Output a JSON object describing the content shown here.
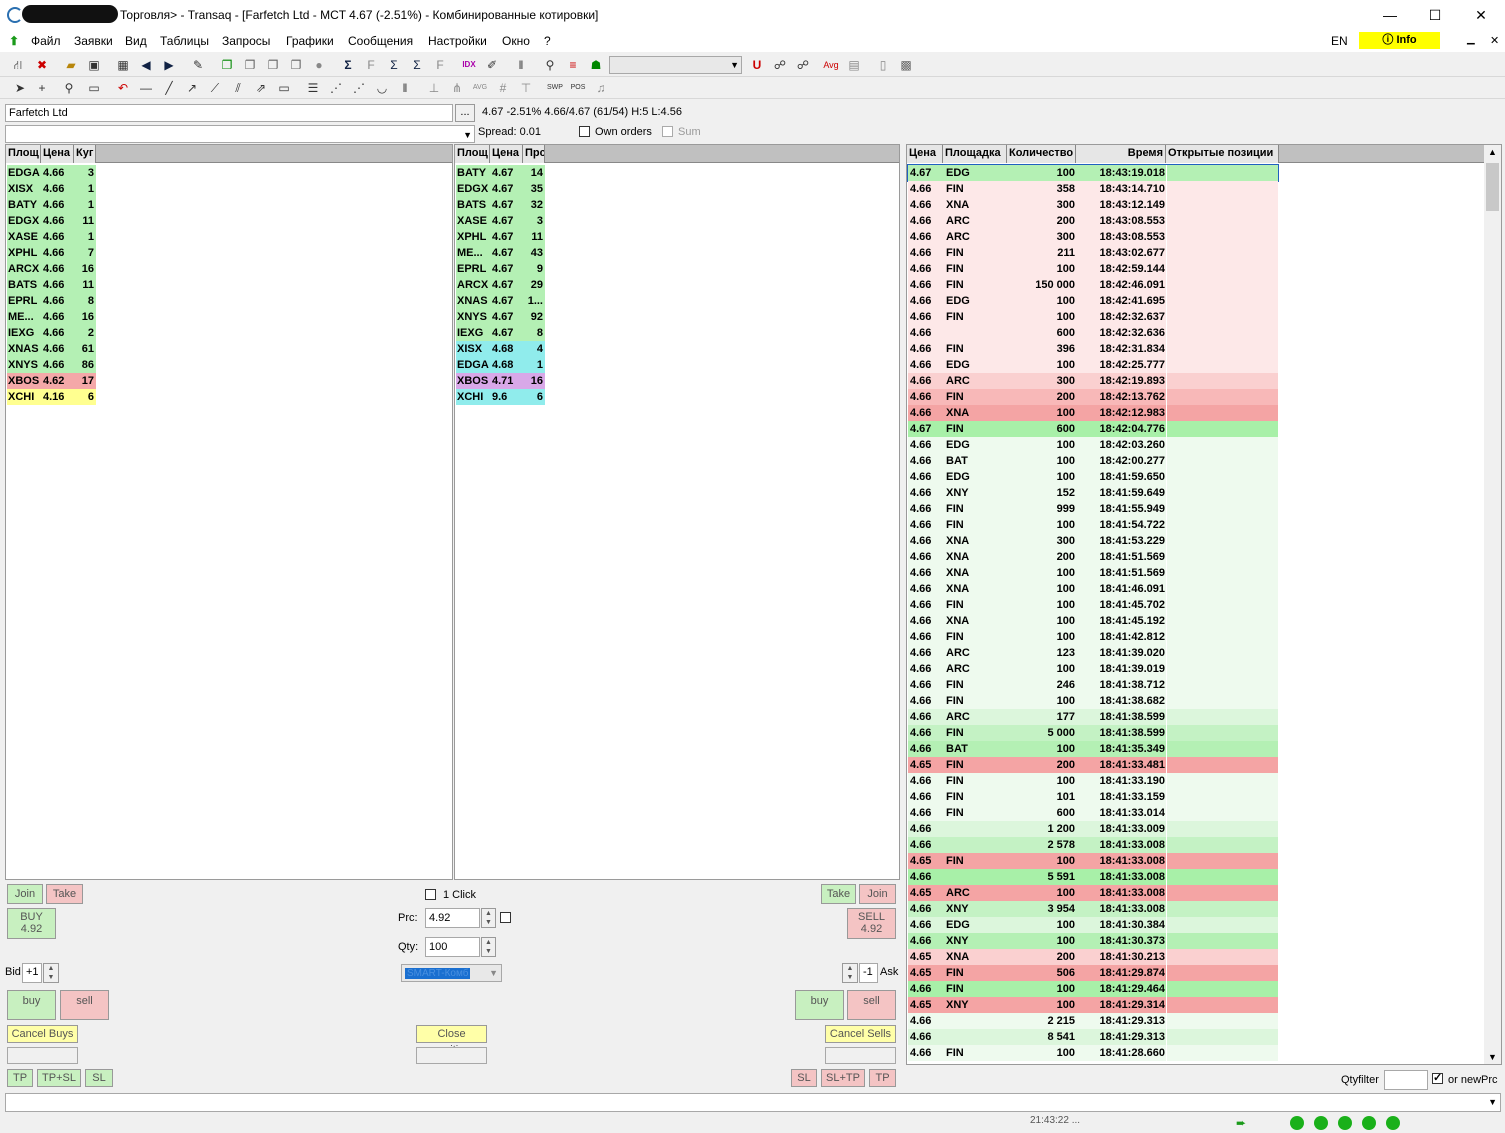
{
  "title": "Торговля> - Transaq - [Farfetch Ltd - MCT 4.67 (-2.51%) - Комбинированные котировки]",
  "menu": [
    "Файл",
    "Заявки",
    "Вид",
    "Таблицы",
    "Запросы",
    "Графики",
    "Сообщения",
    "Настройки",
    "Окно",
    "?"
  ],
  "lang": "EN",
  "info_label": "Info",
  "instrument": "Farfetch Ltd",
  "ellipsis": "...",
  "quote_line": "4.67 -2.51%  4.66/4.67  (61/54)  H:5  L:4.56",
  "spread": "Spread: 0.01",
  "own_orders": "Own orders",
  "sum_label": "Sum",
  "bid_headers": [
    "Площ",
    "Цена",
    "Куг"
  ],
  "bids": [
    {
      "v": "EDGA",
      "p": "4.66",
      "q": "3",
      "c": "#b4f0b4"
    },
    {
      "v": "XISX",
      "p": "4.66",
      "q": "1",
      "c": "#b4f0b4"
    },
    {
      "v": "BATY",
      "p": "4.66",
      "q": "1",
      "c": "#b4f0b4"
    },
    {
      "v": "EDGX",
      "p": "4.66",
      "q": "11",
      "c": "#b4f0b4"
    },
    {
      "v": "XASE",
      "p": "4.66",
      "q": "1",
      "c": "#b4f0b4"
    },
    {
      "v": "XPHL",
      "p": "4.66",
      "q": "7",
      "c": "#b4f0b4"
    },
    {
      "v": "ARCX",
      "p": "4.66",
      "q": "16",
      "c": "#b4f0b4"
    },
    {
      "v": "BATS",
      "p": "4.66",
      "q": "11",
      "c": "#b4f0b4"
    },
    {
      "v": "EPRL",
      "p": "4.66",
      "q": "8",
      "c": "#b4f0b4"
    },
    {
      "v": "ME...",
      "p": "4.66",
      "q": "16",
      "c": "#b4f0b4"
    },
    {
      "v": "IEXG",
      "p": "4.66",
      "q": "2",
      "c": "#b4f0b4"
    },
    {
      "v": "XNAS",
      "p": "4.66",
      "q": "61",
      "c": "#b4f0b4"
    },
    {
      "v": "XNYS",
      "p": "4.66",
      "q": "86",
      "c": "#b4f0b4"
    },
    {
      "v": "XBOS",
      "p": "4.62",
      "q": "17",
      "c": "#f4a8a8"
    },
    {
      "v": "XCHI",
      "p": "4.16",
      "q": "6",
      "c": "#ffff90"
    }
  ],
  "ask_headers": [
    "Площ",
    "Цена",
    "Прс"
  ],
  "asks": [
    {
      "v": "BATY",
      "p": "4.67",
      "q": "14",
      "c": "#b4f0b4"
    },
    {
      "v": "EDGX",
      "p": "4.67",
      "q": "35",
      "c": "#b4f0b4"
    },
    {
      "v": "BATS",
      "p": "4.67",
      "q": "32",
      "c": "#b4f0b4"
    },
    {
      "v": "XASE",
      "p": "4.67",
      "q": "3",
      "c": "#b4f0b4"
    },
    {
      "v": "XPHL",
      "p": "4.67",
      "q": "11",
      "c": "#b4f0b4"
    },
    {
      "v": "ME...",
      "p": "4.67",
      "q": "43",
      "c": "#b4f0b4"
    },
    {
      "v": "EPRL",
      "p": "4.67",
      "q": "9",
      "c": "#b4f0b4"
    },
    {
      "v": "ARCX",
      "p": "4.67",
      "q": "29",
      "c": "#b4f0b4"
    },
    {
      "v": "XNAS",
      "p": "4.67",
      "q": "1...",
      "c": "#b4f0b4"
    },
    {
      "v": "XNYS",
      "p": "4.67",
      "q": "92",
      "c": "#b4f0b4"
    },
    {
      "v": "IEXG",
      "p": "4.67",
      "q": "8",
      "c": "#b4f0b4"
    },
    {
      "v": "XISX",
      "p": "4.68",
      "q": "4",
      "c": "#90ecec"
    },
    {
      "v": "EDGA",
      "p": "4.68",
      "q": "1",
      "c": "#90ecec"
    },
    {
      "v": "XBOS",
      "p": "4.71",
      "q": "16",
      "c": "#d8a8e8"
    },
    {
      "v": "XCHI",
      "p": "9.6",
      "q": "6",
      "c": "#90ecec"
    }
  ],
  "trade_headers": [
    "Цена",
    "Площадка",
    "Количество",
    "Время",
    "Открытые позиции"
  ],
  "trades": [
    {
      "p": "4.67",
      "v": "EDG",
      "q": "100",
      "t": "18:43:19.018",
      "c": "#b4f0b4"
    },
    {
      "p": "4.66",
      "v": "FIN",
      "q": "358",
      "t": "18:43:14.710",
      "c": "#fde8e8"
    },
    {
      "p": "4.66",
      "v": "XNA",
      "q": "300",
      "t": "18:43:12.149",
      "c": "#fde8e8"
    },
    {
      "p": "4.66",
      "v": "ARC",
      "q": "200",
      "t": "18:43:08.553",
      "c": "#fde8e8"
    },
    {
      "p": "4.66",
      "v": "ARC",
      "q": "300",
      "t": "18:43:08.553",
      "c": "#fde8e8"
    },
    {
      "p": "4.66",
      "v": "FIN",
      "q": "211",
      "t": "18:43:02.677",
      "c": "#fde8e8"
    },
    {
      "p": "4.66",
      "v": "FIN",
      "q": "100",
      "t": "18:42:59.144",
      "c": "#fde8e8"
    },
    {
      "p": "4.66",
      "v": "FIN",
      "q": "150 000",
      "t": "18:42:46.091",
      "c": "#fde8e8"
    },
    {
      "p": "4.66",
      "v": "EDG",
      "q": "100",
      "t": "18:42:41.695",
      "c": "#fde8e8"
    },
    {
      "p": "4.66",
      "v": "FIN",
      "q": "100",
      "t": "18:42:32.637",
      "c": "#fde8e8"
    },
    {
      "p": "4.66",
      "v": "",
      "q": "600",
      "t": "18:42:32.636",
      "c": "#fde8e8"
    },
    {
      "p": "4.66",
      "v": "FIN",
      "q": "396",
      "t": "18:42:31.834",
      "c": "#fde8e8"
    },
    {
      "p": "4.66",
      "v": "EDG",
      "q": "100",
      "t": "18:42:25.777",
      "c": "#fde8e8"
    },
    {
      "p": "4.66",
      "v": "ARC",
      "q": "300",
      "t": "18:42:19.893",
      "c": "#fad0d0"
    },
    {
      "p": "4.66",
      "v": "FIN",
      "q": "200",
      "t": "18:42:13.762",
      "c": "#f8b8b8"
    },
    {
      "p": "4.66",
      "v": "XNA",
      "q": "100",
      "t": "18:42:12.983",
      "c": "#f4a4a4"
    },
    {
      "p": "4.67",
      "v": "FIN",
      "q": "600",
      "t": "18:42:04.776",
      "c": "#a8f0a8"
    },
    {
      "p": "4.66",
      "v": "EDG",
      "q": "100",
      "t": "18:42:03.260",
      "c": "#eefaee"
    },
    {
      "p": "4.66",
      "v": "BAT",
      "q": "100",
      "t": "18:42:00.277",
      "c": "#eefaee"
    },
    {
      "p": "4.66",
      "v": "EDG",
      "q": "100",
      "t": "18:41:59.650",
      "c": "#eefaee"
    },
    {
      "p": "4.66",
      "v": "XNY",
      "q": "152",
      "t": "18:41:59.649",
      "c": "#eefaee"
    },
    {
      "p": "4.66",
      "v": "FIN",
      "q": "999",
      "t": "18:41:55.949",
      "c": "#eefaee"
    },
    {
      "p": "4.66",
      "v": "FIN",
      "q": "100",
      "t": "18:41:54.722",
      "c": "#eefaee"
    },
    {
      "p": "4.66",
      "v": "XNA",
      "q": "300",
      "t": "18:41:53.229",
      "c": "#eefaee"
    },
    {
      "p": "4.66",
      "v": "XNA",
      "q": "200",
      "t": "18:41:51.569",
      "c": "#eefaee"
    },
    {
      "p": "4.66",
      "v": "XNA",
      "q": "100",
      "t": "18:41:51.569",
      "c": "#eefaee"
    },
    {
      "p": "4.66",
      "v": "XNA",
      "q": "100",
      "t": "18:41:46.091",
      "c": "#eefaee"
    },
    {
      "p": "4.66",
      "v": "FIN",
      "q": "100",
      "t": "18:41:45.702",
      "c": "#eefaee"
    },
    {
      "p": "4.66",
      "v": "XNA",
      "q": "100",
      "t": "18:41:45.192",
      "c": "#eefaee"
    },
    {
      "p": "4.66",
      "v": "FIN",
      "q": "100",
      "t": "18:41:42.812",
      "c": "#eefaee"
    },
    {
      "p": "4.66",
      "v": "ARC",
      "q": "123",
      "t": "18:41:39.020",
      "c": "#eefaee"
    },
    {
      "p": "4.66",
      "v": "ARC",
      "q": "100",
      "t": "18:41:39.019",
      "c": "#eefaee"
    },
    {
      "p": "4.66",
      "v": "FIN",
      "q": "246",
      "t": "18:41:38.712",
      "c": "#eefaee"
    },
    {
      "p": "4.66",
      "v": "FIN",
      "q": "100",
      "t": "18:41:38.682",
      "c": "#eefaee"
    },
    {
      "p": "4.66",
      "v": "ARC",
      "q": "177",
      "t": "18:41:38.599",
      "c": "#dcf6dc"
    },
    {
      "p": "4.66",
      "v": "FIN",
      "q": "5 000",
      "t": "18:41:38.599",
      "c": "#c4f2c4"
    },
    {
      "p": "4.66",
      "v": "BAT",
      "q": "100",
      "t": "18:41:35.349",
      "c": "#b4f0b4"
    },
    {
      "p": "4.65",
      "v": "FIN",
      "q": "200",
      "t": "18:41:33.481",
      "c": "#f4a4a4"
    },
    {
      "p": "4.66",
      "v": "FIN",
      "q": "100",
      "t": "18:41:33.190",
      "c": "#eefaee"
    },
    {
      "p": "4.66",
      "v": "FIN",
      "q": "101",
      "t": "18:41:33.159",
      "c": "#eefaee"
    },
    {
      "p": "4.66",
      "v": "FIN",
      "q": "600",
      "t": "18:41:33.014",
      "c": "#eefaee"
    },
    {
      "p": "4.66",
      "v": "",
      "q": "1 200",
      "t": "18:41:33.009",
      "c": "#dcf6dc"
    },
    {
      "p": "4.66",
      "v": "",
      "q": "2 578",
      "t": "18:41:33.008",
      "c": "#c4f2c4"
    },
    {
      "p": "4.65",
      "v": "FIN",
      "q": "100",
      "t": "18:41:33.008",
      "c": "#f4a4a4"
    },
    {
      "p": "4.66",
      "v": "",
      "q": "5 591",
      "t": "18:41:33.008",
      "c": "#a8f0a8"
    },
    {
      "p": "4.65",
      "v": "ARC",
      "q": "100",
      "t": "18:41:33.008",
      "c": "#f4a4a4"
    },
    {
      "p": "4.66",
      "v": "XNY",
      "q": "3 954",
      "t": "18:41:33.008",
      "c": "#c4f2c4"
    },
    {
      "p": "4.66",
      "v": "EDG",
      "q": "100",
      "t": "18:41:30.384",
      "c": "#dcf6dc"
    },
    {
      "p": "4.66",
      "v": "XNY",
      "q": "100",
      "t": "18:41:30.373",
      "c": "#b4f0b4"
    },
    {
      "p": "4.65",
      "v": "XNA",
      "q": "200",
      "t": "18:41:30.213",
      "c": "#fad0d0"
    },
    {
      "p": "4.65",
      "v": "FIN",
      "q": "506",
      "t": "18:41:29.874",
      "c": "#f4a4a4"
    },
    {
      "p": "4.66",
      "v": "FIN",
      "q": "100",
      "t": "18:41:29.464",
      "c": "#a8f0a8"
    },
    {
      "p": "4.65",
      "v": "XNY",
      "q": "100",
      "t": "18:41:29.314",
      "c": "#f4a4a4"
    },
    {
      "p": "4.66",
      "v": "",
      "q": "2 215",
      "t": "18:41:29.313",
      "c": "#eefaee"
    },
    {
      "p": "4.66",
      "v": "",
      "q": "8 541",
      "t": "18:41:29.313",
      "c": "#dcf6dc"
    },
    {
      "p": "4.66",
      "v": "FIN",
      "q": "100",
      "t": "18:41:28.660",
      "c": "#eefaee"
    }
  ],
  "order_panel": {
    "join": "Join",
    "take": "Take",
    "buy_label": "BUY",
    "buy_price": "4.92",
    "sell_label": "SELL",
    "sell_price": "4.92",
    "one_click": "1 Click",
    "prc_label": "Prc:",
    "prc_value": "4.92",
    "qty_label": "Qty:",
    "qty_value": "100",
    "route": "SMART-Комб",
    "bid_label": "Bid",
    "bid_offset": "+1",
    "ask_label": "Ask",
    "ask_offset": "-1",
    "buy_small": "buy",
    "sell_small": "sell",
    "cancel_buys": "Cancel Buys",
    "close_position": "Close position",
    "cancel_sells": "Cancel Sells",
    "tp": "TP",
    "tpsl": "TP+SL",
    "sl": "SL",
    "sltp": "SL+TP"
  },
  "qtyfilter_label": "Qtyfilter",
  "or_new_prc": "or newPrc",
  "status_time": "21:43:22 ..."
}
